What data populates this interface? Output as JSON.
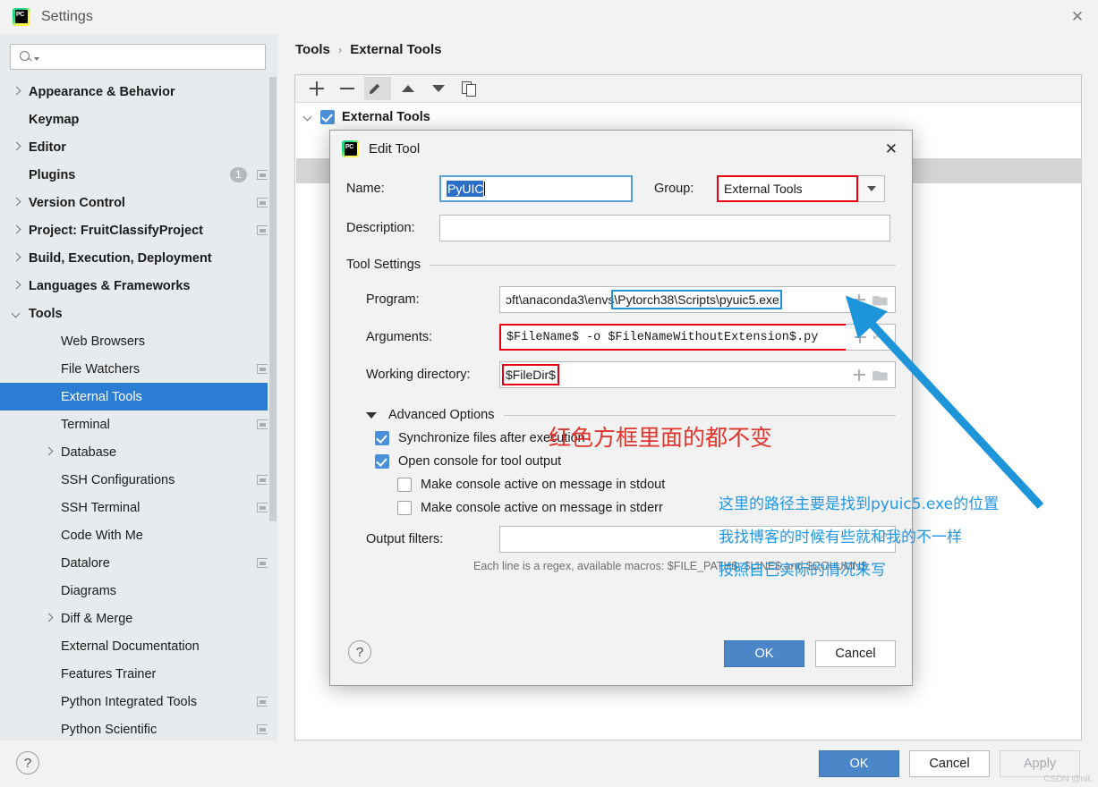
{
  "window": {
    "title": "Settings",
    "close_label": "✕",
    "logo_text": "PC"
  },
  "search": {
    "value": "",
    "placeholder": ""
  },
  "sidebar": {
    "items": [
      {
        "label": "Appearance & Behavior",
        "twisty": "right",
        "indent": 0,
        "bold": true,
        "badge": null,
        "proj_icon": false,
        "selected": false
      },
      {
        "label": "Keymap",
        "twisty": "none",
        "indent": 0,
        "bold": true,
        "badge": null,
        "proj_icon": false,
        "selected": false
      },
      {
        "label": "Editor",
        "twisty": "right",
        "indent": 0,
        "bold": true,
        "badge": null,
        "proj_icon": false,
        "selected": false
      },
      {
        "label": "Plugins",
        "twisty": "none",
        "indent": 0,
        "bold": true,
        "badge": "1",
        "proj_icon": true,
        "selected": false
      },
      {
        "label": "Version Control",
        "twisty": "right",
        "indent": 0,
        "bold": true,
        "badge": null,
        "proj_icon": true,
        "selected": false
      },
      {
        "label": "Project: FruitClassifyProject",
        "twisty": "right",
        "indent": 0,
        "bold": true,
        "badge": null,
        "proj_icon": true,
        "selected": false
      },
      {
        "label": "Build, Execution, Deployment",
        "twisty": "right",
        "indent": 0,
        "bold": true,
        "badge": null,
        "proj_icon": false,
        "selected": false
      },
      {
        "label": "Languages & Frameworks",
        "twisty": "right",
        "indent": 0,
        "bold": true,
        "badge": null,
        "proj_icon": false,
        "selected": false
      },
      {
        "label": "Tools",
        "twisty": "down",
        "indent": 0,
        "bold": true,
        "badge": null,
        "proj_icon": false,
        "selected": false
      },
      {
        "label": "Web Browsers",
        "twisty": "none",
        "indent": 1,
        "bold": false,
        "badge": null,
        "proj_icon": false,
        "selected": false
      },
      {
        "label": "File Watchers",
        "twisty": "none",
        "indent": 1,
        "bold": false,
        "badge": null,
        "proj_icon": true,
        "selected": false
      },
      {
        "label": "External Tools",
        "twisty": "none",
        "indent": 1,
        "bold": false,
        "badge": null,
        "proj_icon": false,
        "selected": true
      },
      {
        "label": "Terminal",
        "twisty": "none",
        "indent": 1,
        "bold": false,
        "badge": null,
        "proj_icon": true,
        "selected": false
      },
      {
        "label": "Database",
        "twisty": "right",
        "indent": 1,
        "bold": false,
        "badge": null,
        "proj_icon": false,
        "selected": false
      },
      {
        "label": "SSH Configurations",
        "twisty": "none",
        "indent": 1,
        "bold": false,
        "badge": null,
        "proj_icon": true,
        "selected": false
      },
      {
        "label": "SSH Terminal",
        "twisty": "none",
        "indent": 1,
        "bold": false,
        "badge": null,
        "proj_icon": true,
        "selected": false
      },
      {
        "label": "Code With Me",
        "twisty": "none",
        "indent": 1,
        "bold": false,
        "badge": null,
        "proj_icon": false,
        "selected": false
      },
      {
        "label": "Datalore",
        "twisty": "none",
        "indent": 1,
        "bold": false,
        "badge": null,
        "proj_icon": true,
        "selected": false
      },
      {
        "label": "Diagrams",
        "twisty": "none",
        "indent": 1,
        "bold": false,
        "badge": null,
        "proj_icon": false,
        "selected": false
      },
      {
        "label": "Diff & Merge",
        "twisty": "right",
        "indent": 1,
        "bold": false,
        "badge": null,
        "proj_icon": false,
        "selected": false
      },
      {
        "label": "External Documentation",
        "twisty": "none",
        "indent": 1,
        "bold": false,
        "badge": null,
        "proj_icon": false,
        "selected": false
      },
      {
        "label": "Features Trainer",
        "twisty": "none",
        "indent": 1,
        "bold": false,
        "badge": null,
        "proj_icon": false,
        "selected": false
      },
      {
        "label": "Python Integrated Tools",
        "twisty": "none",
        "indent": 1,
        "bold": false,
        "badge": null,
        "proj_icon": true,
        "selected": false
      },
      {
        "label": "Python Scientific",
        "twisty": "none",
        "indent": 1,
        "bold": false,
        "badge": null,
        "proj_icon": true,
        "selected": false
      }
    ]
  },
  "breadcrumb": {
    "parent": "Tools",
    "separator": "›",
    "current": "External Tools"
  },
  "toolbar": {
    "add_label": "+",
    "remove_label": "−",
    "edit_label": "edit",
    "up_label": "up",
    "down_label": "down",
    "copy_label": "copy"
  },
  "tools_tree": {
    "group_label": "External Tools",
    "group_checked": true
  },
  "dialog": {
    "title": "Edit Tool",
    "close_label": "✕",
    "name_label": "Name:",
    "name_value": "PyUIC",
    "group_label": "Group:",
    "group_value": "External Tools",
    "description_label": "Description:",
    "description_value": "",
    "tool_settings_label": "Tool Settings",
    "program_label": "Program:",
    "program_value_prefix": "ɔft\\anaconda3\\envs",
    "program_value_highlight": "\\Pytorch38\\Scripts\\pyuic5.exe",
    "arguments_label": "Arguments:",
    "arguments_value": "$FileName$ -o $FileNameWithoutExtension$.py",
    "working_dir_label": "Working directory:",
    "working_dir_value": "$FileDir$",
    "advanced_options_label": "Advanced Options",
    "checkboxes": [
      {
        "label": "Synchronize files after execution",
        "checked": true,
        "indent": 0
      },
      {
        "label": "Open console for tool output",
        "checked": true,
        "indent": 0
      },
      {
        "label": "Make console active on message in stdout",
        "checked": false,
        "indent": 1
      },
      {
        "label": "Make console active on message in stderr",
        "checked": false,
        "indent": 1
      }
    ],
    "output_filters_label": "Output filters:",
    "output_filters_value": "",
    "regex_hint": "Each line is a regex, available macros: $FILE_PATH$, $LINE$ and $COLUMN$",
    "help_label": "?",
    "ok_label": "OK",
    "cancel_label": "Cancel"
  },
  "annotations": {
    "red_note": "红色方框里面的都不变",
    "blue_line1": "这里的路径主要是找到pyuic5.exe的位置",
    "blue_line2": "我找博客的时候有些就和我的不一样",
    "blue_line3": "按照自己实际的情况来写",
    "red_color": "#e3342c",
    "blue_color": "#2196e3",
    "arrow_color": "#1e95d8"
  },
  "footer": {
    "help_label": "?",
    "ok_label": "OK",
    "cancel_label": "Cancel",
    "apply_label": "Apply",
    "watermark": "CSDN @nit."
  }
}
